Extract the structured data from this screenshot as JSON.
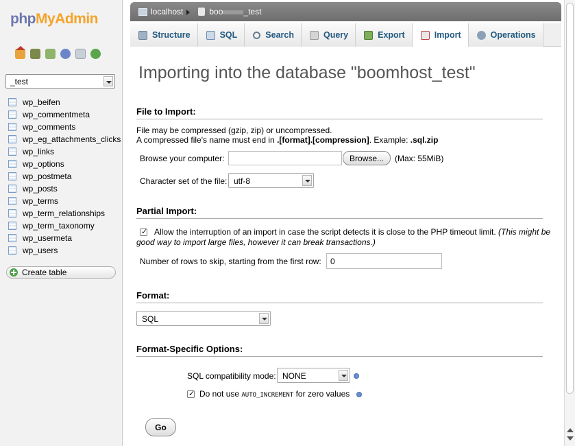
{
  "logo": {
    "php": "php",
    "myadmin": "MyAdmin"
  },
  "sidebar": {
    "db_selected": "_test",
    "tables": [
      "wp_beifen",
      "wp_commentmeta",
      "wp_comments",
      "wp_eg_attachments_clicks",
      "wp_links",
      "wp_options",
      "wp_postmeta",
      "wp_posts",
      "wp_terms",
      "wp_term_relationships",
      "wp_term_taxonomy",
      "wp_usermeta",
      "wp_users"
    ],
    "create_table": "Create table"
  },
  "breadcrumb": {
    "server": "localhost",
    "db_prefix": "boo",
    "db_suffix": "_test"
  },
  "tabs": [
    {
      "label": "Structure",
      "icon": "structure-icon"
    },
    {
      "label": "SQL",
      "icon": "sql-icon"
    },
    {
      "label": "Search",
      "icon": "search-icon"
    },
    {
      "label": "Query",
      "icon": "query-icon"
    },
    {
      "label": "Export",
      "icon": "export-icon"
    },
    {
      "label": "Import",
      "icon": "import-icon"
    },
    {
      "label": "Operations",
      "icon": "operations-icon"
    }
  ],
  "active_tab": "Import",
  "main": {
    "title": "Importing into the database \"boomhost_test\"",
    "file_section": {
      "heading": "File to Import:",
      "note1": "File may be compressed (gzip, zip) or uncompressed.",
      "note2_prefix": "A compressed file's name must end in ",
      "note2_bold": ".[format].[compression]",
      "note2_mid": ". Example: ",
      "note2_example": ".sql.zip",
      "browse_label": "Browse your computer:",
      "browse_button": "Browse...",
      "max_size": "(Max: 55MiB)",
      "charset_label": "Character set of the file:",
      "charset_value": "utf-8"
    },
    "partial_section": {
      "heading": "Partial Import:",
      "allow_interrupt": "Allow the interruption of an import in case the script detects it is close to the PHP timeout limit.",
      "allow_interrupt_note_1": "(This might be",
      "allow_interrupt_note_2": "good way to import large files, however it can break transactions.)",
      "skip_label": "Number of rows to skip, starting from the first row:",
      "skip_value": "0"
    },
    "format_section": {
      "heading": "Format:",
      "value": "SQL"
    },
    "options_section": {
      "heading": "Format-Specific Options:",
      "compat_label": "SQL compatibility mode:",
      "compat_value": "NONE",
      "no_auto_pre": "Do not use ",
      "no_auto_code": "AUTO_INCREMENT",
      "no_auto_post": " for zero values"
    },
    "go_button": "Go"
  }
}
